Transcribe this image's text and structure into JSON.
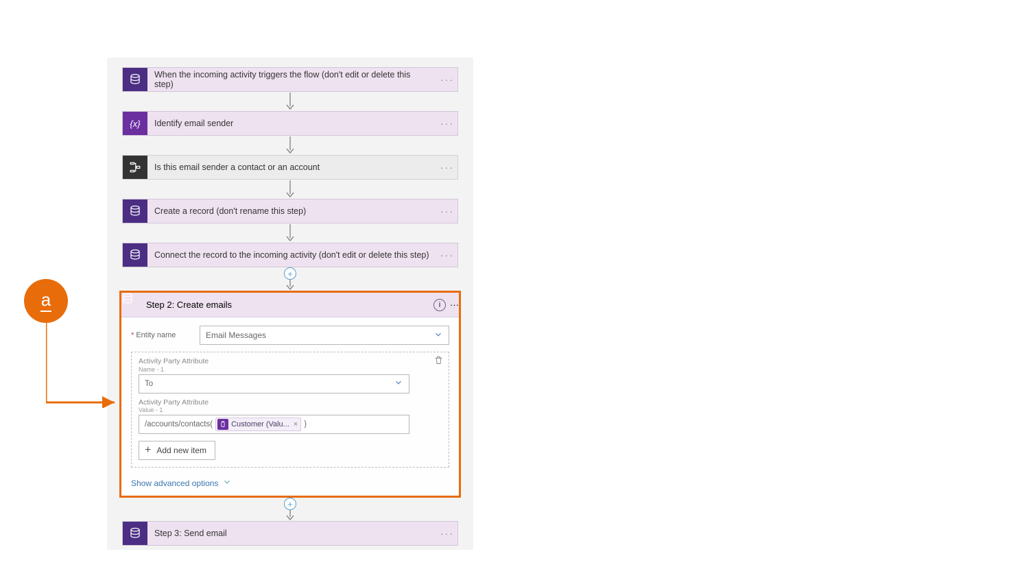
{
  "callout": {
    "label": "a"
  },
  "steps": [
    {
      "id": "step1",
      "label": "When the incoming activity triggers the flow (don't edit or delete this step)",
      "icon": "database",
      "tone": "purple"
    },
    {
      "id": "step2",
      "label": "Identify email sender",
      "icon": "variable",
      "tone": "darkpurple"
    },
    {
      "id": "step3",
      "label": "Is this email sender a contact or an account",
      "icon": "switch",
      "tone": "dark",
      "bg": "gray"
    },
    {
      "id": "step4",
      "label": "Create a record (don't rename this step)",
      "icon": "database",
      "tone": "purple"
    },
    {
      "id": "step5",
      "label": "Connect the record to the incoming activity (don't edit or delete this step)",
      "icon": "database",
      "tone": "purple"
    }
  ],
  "expanded": {
    "title": "Step 2: Create emails",
    "entity_label": "Entity name",
    "entity_value": "Email Messages",
    "attr1": {
      "label": "Activity Party Attribute",
      "sub": "Name - 1",
      "value": "To"
    },
    "attr2": {
      "label": "Activity Party Attribute",
      "sub": "Value - 1",
      "prefix": "/accounts/contacts(",
      "token": "Customer (Valu...",
      "suffix": ")"
    },
    "add_item": "Add new item",
    "show_adv": "Show advanced options"
  },
  "step_final": {
    "label": "Step 3: Send email",
    "icon": "database",
    "tone": "purple"
  }
}
